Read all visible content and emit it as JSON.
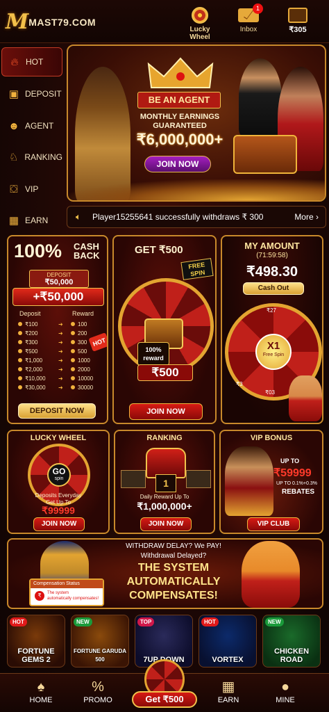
{
  "header": {
    "logo_mark": "M",
    "logo_text": "MAST79.COM",
    "lucky_wheel_label": "Lucky\nWheel",
    "inbox_label": "Inbox",
    "inbox_badge": "1",
    "wallet_amount": "₹305"
  },
  "sidebar": {
    "items": [
      {
        "label": "HOT",
        "icon": "flame-icon"
      },
      {
        "label": "DEPOSIT",
        "icon": "deposit-icon"
      },
      {
        "label": "AGENT",
        "icon": "agent-icon"
      },
      {
        "label": "RANKING",
        "icon": "trophy-icon"
      },
      {
        "label": "VIP",
        "icon": "vip-shield-icon"
      },
      {
        "label": "EARN",
        "icon": "gift-icon"
      }
    ]
  },
  "banner": {
    "tag": "BE AN AGENT",
    "subtitle": "MONTHLY EARNINGS\nGUARANTEED",
    "amount": "₹6,000,000+",
    "button": "JOIN NOW"
  },
  "marquee": {
    "text": "Player15255641 successfully withdraws ₹ 300",
    "more": "More"
  },
  "cashback_card": {
    "title_big": "100%",
    "title_small": "CASH\nBACK",
    "deposit_tag": "DEPOSIT",
    "deposit_amount": "₹50,000",
    "bonus": "+₹50,000",
    "hot_tag": "HOT",
    "col_deposit": "Deposit",
    "col_reward": "Reward",
    "rows": [
      {
        "deposit": "₹100",
        "reward": "100"
      },
      {
        "deposit": "₹200",
        "reward": "200"
      },
      {
        "deposit": "₹300",
        "reward": "300"
      },
      {
        "deposit": "₹500",
        "reward": "500"
      },
      {
        "deposit": "₹1,000",
        "reward": "1000"
      },
      {
        "deposit": "₹2,000",
        "reward": "2000"
      },
      {
        "deposit": "₹10,000",
        "reward": "10000"
      },
      {
        "deposit": "₹30,000",
        "reward": "30000"
      }
    ],
    "button": "DEPOSIT NOW"
  },
  "spin_card": {
    "title": "GET ₹500",
    "free_spin": "FREE\nSPIN",
    "reward_badge": "100%\nreward",
    "prize": "₹500",
    "button": "JOIN NOW"
  },
  "amount_card": {
    "title": "MY AMOUNT",
    "timer": "(71:59:58)",
    "amount": "₹498.30",
    "button": "Cash Out",
    "wheel_center": "X1",
    "wheel_center_sub": "Free Spin",
    "wheel_top": "₹27",
    "wheel_bottom": "₹03",
    "wheel_left": "₹3",
    "wheel_right": "₹1"
  },
  "lucky_card": {
    "title": "LUCKY WHEEL",
    "center": "GO",
    "center_sub": "spin",
    "line1": "Deposits Everyday",
    "line2": "Get   Up To",
    "amount": "₹99999",
    "button": "JOIN NOW"
  },
  "ranking_card": {
    "title": "RANKING",
    "rank": "1",
    "line1": "Daily Reward Up To",
    "amount": "₹1,000,000+",
    "button": "JOIN NOW"
  },
  "vip_card": {
    "title": "VIP BONUS",
    "up_to": "UP TO",
    "amount": "₹59999",
    "up_to_pct": "UP TO 0.1%+0.3%",
    "rebates": "REBATES",
    "button": "VIP CLUB"
  },
  "compensate_banner": {
    "line1": "WITHDRAW DELAY? We PAY!",
    "line2": "Withdrawal Delayed?",
    "line3": "THE SYSTEM",
    "line4": "AUTOMATICALLY",
    "line5": "COMPENSATES!",
    "status_title": "Compensation Status",
    "status_text": "The system\nautomatically compensates!"
  },
  "games": [
    {
      "tag": "HOT",
      "name": "FORTUNE\nGEMS 2",
      "color1": "#7a3a0a",
      "color2": "#2a0c04"
    },
    {
      "tag": "NEW",
      "name": "FORTUNE GARUDA\n500",
      "color1": "#8a4a0c",
      "color2": "#3a1404"
    },
    {
      "tag": "TOP",
      "name": "7UP DOWN",
      "color1": "#2a2a5a",
      "color2": "#0c0c2a"
    },
    {
      "tag": "HOT",
      "name": "VORTEX",
      "color1": "#0c2a6a",
      "color2": "#081030"
    },
    {
      "tag": "NEW",
      "name": "CHICKEN\nROAD",
      "color1": "#1a6a2a",
      "color2": "#0a3012"
    }
  ],
  "nav": {
    "home": "HOME",
    "promo": "PROMO",
    "get": "Get ₹500",
    "earn": "EARN",
    "mine": "MINE"
  },
  "colors": {
    "gold": "#f1c24c",
    "red": "#d61a14",
    "purple": "#a51fbf",
    "bg": "#1a0705"
  }
}
